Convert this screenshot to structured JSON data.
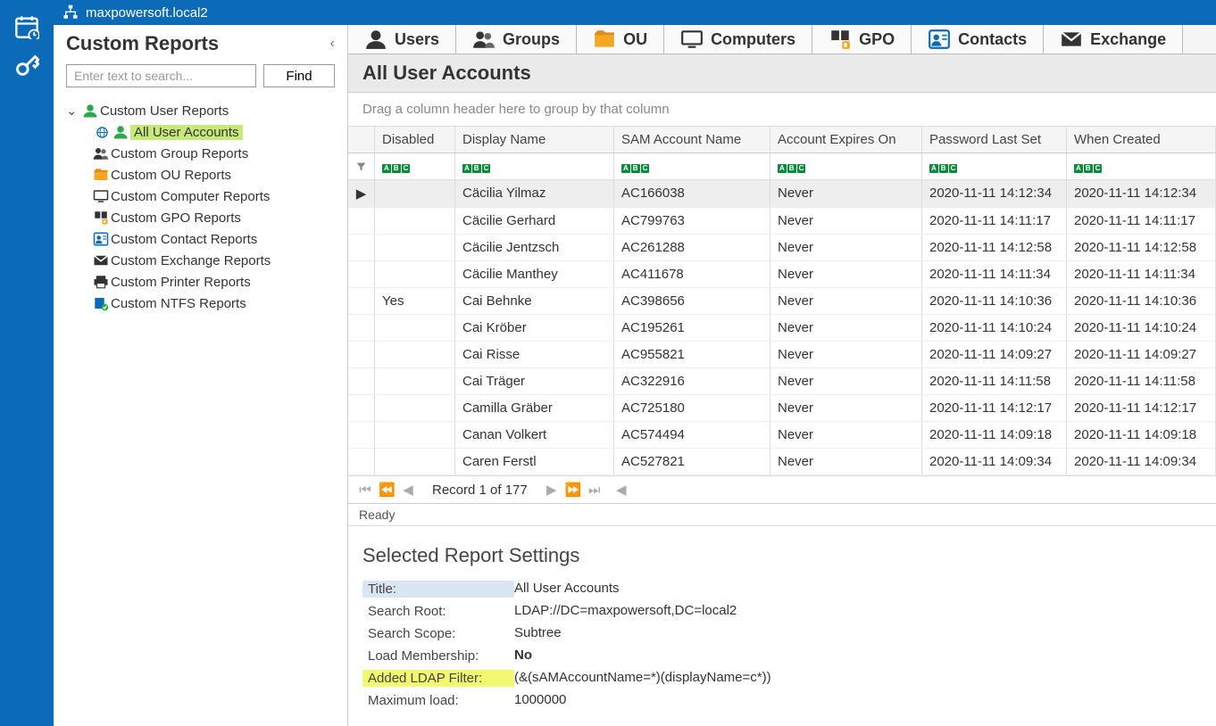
{
  "title": "maxpowersoft.local2",
  "sidebar": {
    "title": "Custom Reports",
    "search_placeholder": "Enter text to search...",
    "find_label": "Find",
    "root": "Custom User Reports",
    "selected": "All User Accounts",
    "items": [
      {
        "label": "Custom Group Reports",
        "icon": "groups"
      },
      {
        "label": "Custom OU Reports",
        "icon": "ou"
      },
      {
        "label": "Custom Computer Reports",
        "icon": "computer"
      },
      {
        "label": "Custom GPO Reports",
        "icon": "gpo"
      },
      {
        "label": "Custom Contact Reports",
        "icon": "contact"
      },
      {
        "label": "Custom Exchange Reports",
        "icon": "exchange"
      },
      {
        "label": "Custom Printer Reports",
        "icon": "printer"
      },
      {
        "label": "Custom NTFS Reports",
        "icon": "ntfs"
      }
    ]
  },
  "tabs": [
    {
      "label": "Users",
      "icon": "users"
    },
    {
      "label": "Groups",
      "icon": "groups"
    },
    {
      "label": "OU",
      "icon": "ou",
      "active": true
    },
    {
      "label": "Computers",
      "icon": "computer"
    },
    {
      "label": "GPO",
      "icon": "gpo"
    },
    {
      "label": "Contacts",
      "icon": "contact"
    },
    {
      "label": "Exchange",
      "icon": "exchange"
    }
  ],
  "grid": {
    "title": "All User Accounts",
    "group_hint": "Drag a column header here to group by that column",
    "columns": [
      "Disabled",
      "Display Name",
      "SAM Account Name",
      "Account Expires On",
      "Password Last Set",
      "When Created"
    ],
    "rows": [
      {
        "sel": true,
        "disabled": "",
        "dn": "Cäcilia Yilmaz",
        "sam": "AC166038",
        "exp": "Never",
        "pls": "2020-11-11 14:12:34",
        "wc": "2020-11-11 14:12:34"
      },
      {
        "disabled": "",
        "dn": "Cäcilie Gerhard",
        "sam": "AC799763",
        "exp": "Never",
        "pls": "2020-11-11 14:11:17",
        "wc": "2020-11-11 14:11:17"
      },
      {
        "disabled": "",
        "dn": "Cäcilie Jentzsch",
        "sam": "AC261288",
        "exp": "Never",
        "pls": "2020-11-11 14:12:58",
        "wc": "2020-11-11 14:12:58"
      },
      {
        "disabled": "",
        "dn": "Cäcilie Manthey",
        "sam": "AC411678",
        "exp": "Never",
        "pls": "2020-11-11 14:11:34",
        "wc": "2020-11-11 14:11:34"
      },
      {
        "disabled": "Yes",
        "dn": "Cai Behnke",
        "sam": "AC398656",
        "exp": "Never",
        "pls": "2020-11-11 14:10:36",
        "wc": "2020-11-11 14:10:36"
      },
      {
        "disabled": "",
        "dn": "Cai Kröber",
        "sam": "AC195261",
        "exp": "Never",
        "pls": "2020-11-11 14:10:24",
        "wc": "2020-11-11 14:10:24"
      },
      {
        "disabled": "",
        "dn": "Cai Risse",
        "sam": "AC955821",
        "exp": "Never",
        "pls": "2020-11-11 14:09:27",
        "wc": "2020-11-11 14:09:27"
      },
      {
        "disabled": "",
        "dn": "Cai Träger",
        "sam": "AC322916",
        "exp": "Never",
        "pls": "2020-11-11 14:11:58",
        "wc": "2020-11-11 14:11:58"
      },
      {
        "disabled": "",
        "dn": "Camilla Gräber",
        "sam": "AC725180",
        "exp": "Never",
        "pls": "2020-11-11 14:12:17",
        "wc": "2020-11-11 14:12:17"
      },
      {
        "disabled": "",
        "dn": "Canan Volkert",
        "sam": "AC574494",
        "exp": "Never",
        "pls": "2020-11-11 14:09:18",
        "wc": "2020-11-11 14:09:18"
      },
      {
        "disabled": "",
        "dn": "Caren Ferstl",
        "sam": "AC527821",
        "exp": "Never",
        "pls": "2020-11-11 14:09:34",
        "wc": "2020-11-11 14:09:34"
      }
    ],
    "pager": "Record 1 of 177",
    "status": "Ready"
  },
  "settings": {
    "title": "Selected Report Settings",
    "rows": [
      {
        "label": "Title:",
        "value": "All User Accounts",
        "first": true
      },
      {
        "label": "Search Root:",
        "value": "LDAP://DC=maxpowersoft,DC=local2"
      },
      {
        "label": "Search Scope:",
        "value": "Subtree"
      },
      {
        "label": "Load Membership:",
        "value": "No",
        "bold": true
      },
      {
        "label": "Added LDAP Filter:",
        "value": "(&(sAMAccountName=*)(displayName=c*))",
        "hl": true
      },
      {
        "label": "Maximum load:",
        "value": "1000000"
      }
    ]
  }
}
